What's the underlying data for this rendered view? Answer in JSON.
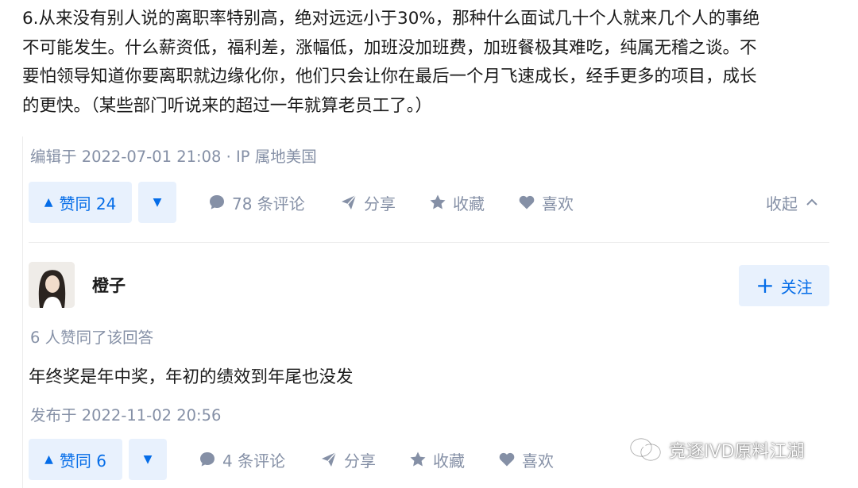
{
  "answer1": {
    "paragraph_lines": [
      "6.从来没有别人说的离职率特别高，绝对远远小于30%，那种什么面试几十个人就来几个人的事绝",
      "不可能发生。什么薪资低，福利差，涨幅低，加班没加班费，加班餐极其难吃，纯属无稽之谈。不",
      "要怕领导知道你要离职就边缘化你，他们只会让你在最后一个月飞速成长，经手更多的项目，成长",
      "的更快。（某些部门听说来的超过一年就算老员工了。）"
    ],
    "edited_meta": "编辑于 2022-07-01 21:08 · IP 属地美国",
    "actions": {
      "upvote_label": "赞同 24",
      "comments_label": "78 条评论",
      "share_label": "分享",
      "favorite_label": "收藏",
      "like_label": "喜欢",
      "collapse_label": "收起"
    }
  },
  "answer2": {
    "author_name": "橙子",
    "follow_label": "关注",
    "vote_summary": "6 人赞同了该回答",
    "content": "年终奖是年中奖，年初的绩效到年尾也没发",
    "published_meta": "发布于 2022-11-02 20:56",
    "actions": {
      "upvote_label": "赞同 6",
      "comments_label": "4 条评论",
      "share_label": "分享",
      "favorite_label": "收藏",
      "like_label": "喜欢"
    }
  },
  "watermark": {
    "text": "竞逐IVD原料江湖"
  },
  "icons": {
    "upvote": "triangle-up-icon",
    "downvote": "triangle-down-icon",
    "comment": "comment-bubble-icon",
    "share": "paper-plane-icon",
    "favorite": "star-icon",
    "like": "heart-icon",
    "collapse": "chevron-up-icon",
    "follow": "plus-icon",
    "watermark": "wechat-icon"
  },
  "colors": {
    "brand_blue": "#056de8",
    "button_bg": "#e8f1fd",
    "meta_gray": "#8590a6",
    "text": "#1a1a1a"
  }
}
